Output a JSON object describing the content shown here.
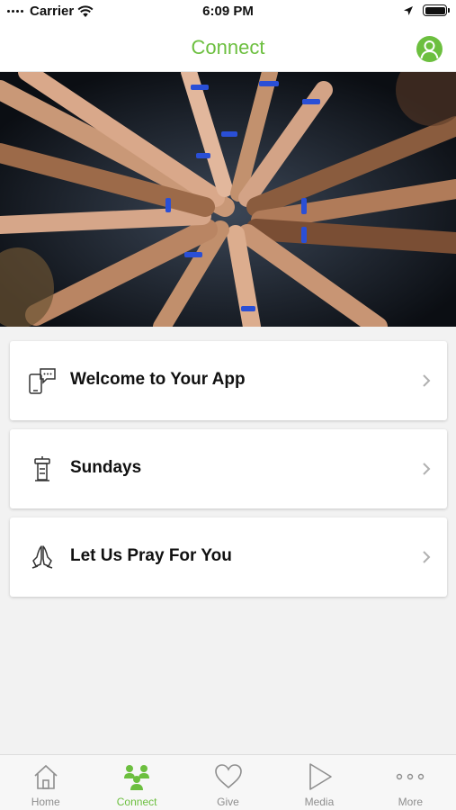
{
  "status_bar": {
    "carrier": "Carrier",
    "time": "6:09 PM"
  },
  "nav": {
    "title": "Connect",
    "profile_icon": "person-icon"
  },
  "hero": {
    "image": "hands-together-photo"
  },
  "cards": [
    {
      "label": "Welcome to Your App",
      "icon": "phone-chat-icon"
    },
    {
      "label": "Sundays",
      "icon": "podium-icon"
    },
    {
      "label": "Let Us Pray For You",
      "icon": "praying-hands-icon"
    }
  ],
  "tabs": [
    {
      "label": "Home",
      "icon": "home-icon",
      "active": false
    },
    {
      "label": "Connect",
      "icon": "people-icon",
      "active": true
    },
    {
      "label": "Give",
      "icon": "heart-icon",
      "active": false
    },
    {
      "label": "Media",
      "icon": "play-icon",
      "active": false
    },
    {
      "label": "More",
      "icon": "more-dots-icon",
      "active": false
    }
  ],
  "colors": {
    "accent": "#6cbf3f",
    "inactive": "#8e8e8e",
    "background": "#f2f2f2"
  }
}
